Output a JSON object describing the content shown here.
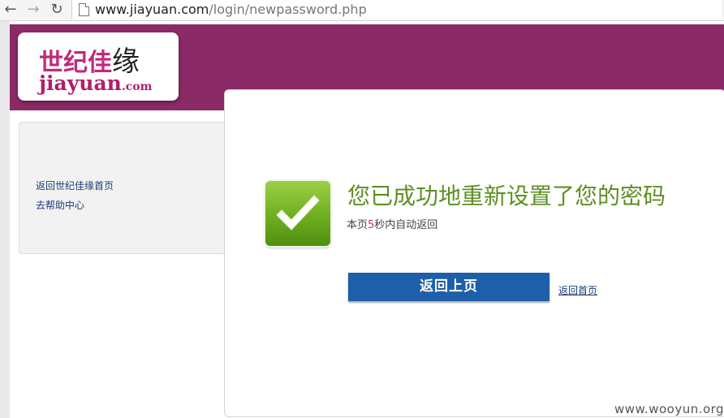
{
  "browser": {
    "url_host": "www.jiayuan.com",
    "url_path": "/login/newpassword.php"
  },
  "logo": {
    "cn_text": "世纪佳",
    "cn_big": "缘",
    "en_text": "jiayuan",
    "en_suffix": ".com"
  },
  "sidebar": {
    "links": [
      {
        "label": "返回世纪佳缘首页"
      },
      {
        "label": "去帮助中心"
      }
    ]
  },
  "main": {
    "title": "您已成功地重新设置了您的密码",
    "auto_return_prefix": "本页",
    "auto_return_count": "5",
    "auto_return_suffix": "秒内自动返回",
    "back_button": "返回上页",
    "home_link": "返回首页"
  },
  "watermark": "www.wooyun.org",
  "colors": {
    "header": "#8b2a66",
    "success_green": "#5d8f22",
    "button_blue": "#1d5fa8",
    "brand_pink": "#c12a7b"
  },
  "icons": [
    "back-arrow-icon",
    "forward-arrow-icon",
    "reload-icon",
    "page-icon",
    "checkmark-icon"
  ]
}
